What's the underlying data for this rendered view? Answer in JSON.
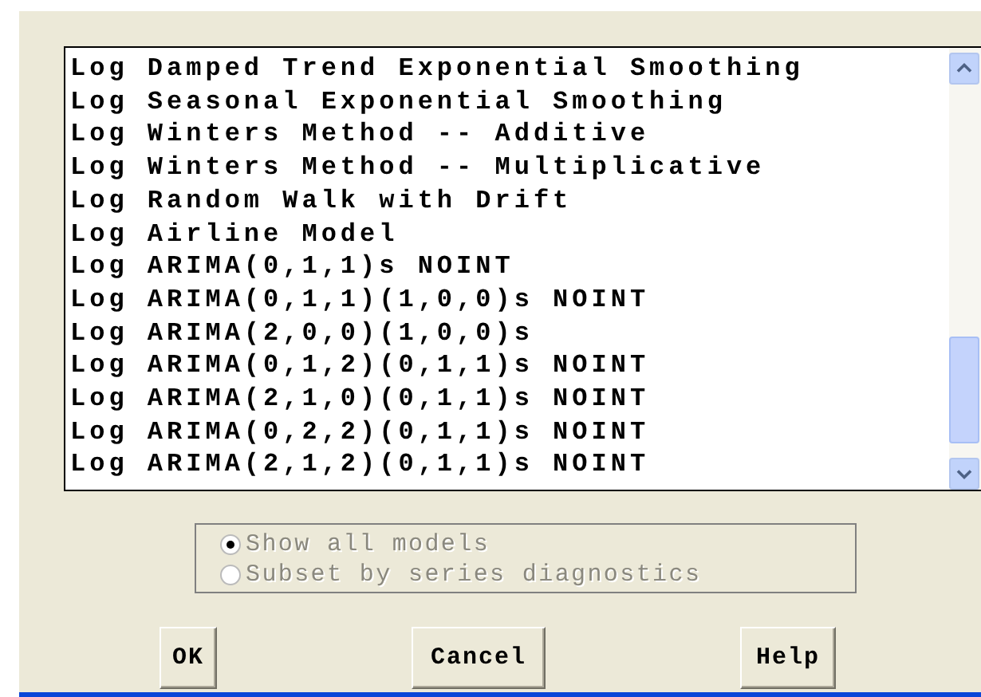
{
  "models": [
    {
      "label": "Log Damped Trend Exponential Smoothing"
    },
    {
      "label": "Log Seasonal Exponential Smoothing"
    },
    {
      "label": "Log Winters Method -- Additive"
    },
    {
      "label": "Log Winters Method -- Multiplicative"
    },
    {
      "label": "Log Random Walk with Drift"
    },
    {
      "label": "Log Airline Model"
    },
    {
      "label": "Log ARIMA(0,1,1)s NOINT"
    },
    {
      "label": "Log ARIMA(0,1,1)(1,0,0)s NOINT"
    },
    {
      "label": "Log ARIMA(2,0,0)(1,0,0)s"
    },
    {
      "label": "Log ARIMA(0,1,2)(0,1,1)s NOINT"
    },
    {
      "label": "Log ARIMA(2,1,0)(0,1,1)s NOINT"
    },
    {
      "label": "Log ARIMA(0,2,2)(0,1,1)s NOINT"
    },
    {
      "label": "Log ARIMA(2,1,2)(0,1,1)s NOINT"
    }
  ],
  "filter_options": [
    {
      "label": "Show all models",
      "selected": true,
      "disabled": true
    },
    {
      "label": "Subset by series diagnostics",
      "selected": false,
      "disabled": true
    }
  ],
  "buttons": [
    {
      "label": "OK"
    },
    {
      "label": "Cancel"
    },
    {
      "label": "Help"
    }
  ]
}
